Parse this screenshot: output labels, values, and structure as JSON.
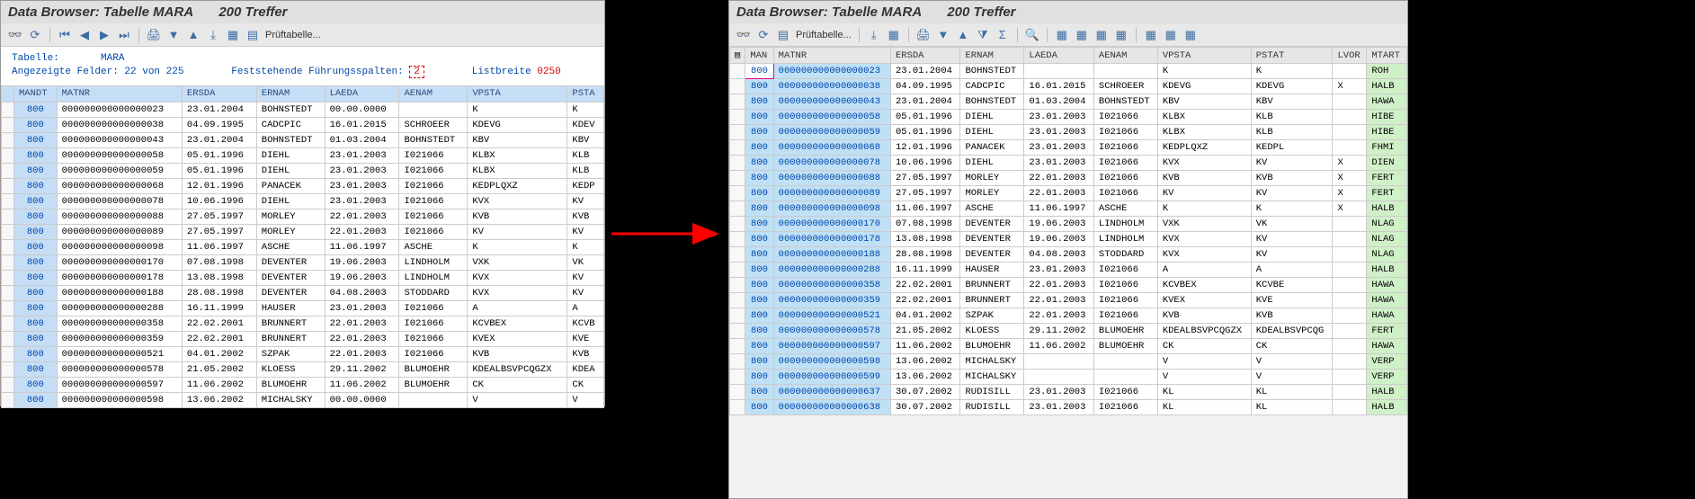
{
  "title_main": "Data Browser: Tabelle MARA",
  "title_hits": "200 Treffer",
  "tb_left_label": "Prüftabelle...",
  "tb_right_label": "Prüftabelle...",
  "info": {
    "tabelle_label": "Tabelle:",
    "tabelle_value": "MARA",
    "felder_label": "Angezeigte Felder: 22 von 225",
    "spalten_label": "Feststehende Führungsspalten:",
    "spalten_value": "2",
    "listbreite_label": "Listbreite",
    "listbreite_value": "0250"
  },
  "left_cols": [
    "",
    "MANDT",
    "MATNR",
    "ERSDA",
    "ERNAM",
    "LAEDA",
    "AENAM",
    "VPSTA",
    "PSTA"
  ],
  "right_cols": [
    "",
    "MAN",
    "MATNR",
    "ERSDA",
    "ERNAM",
    "LAEDA",
    "AENAM",
    "VPSTA",
    "PSTAT",
    "LVOR",
    "MTART"
  ],
  "left_rows": [
    [
      "800",
      "000000000000000023",
      "23.01.2004",
      "BOHNSTEDT",
      "00.00.0000",
      "",
      "K",
      "K"
    ],
    [
      "800",
      "000000000000000038",
      "04.09.1995",
      "CADCPIC",
      "16.01.2015",
      "SCHROEER",
      "KDEVG",
      "KDEV"
    ],
    [
      "800",
      "000000000000000043",
      "23.01.2004",
      "BOHNSTEDT",
      "01.03.2004",
      "BOHNSTEDT",
      "KBV",
      "KBV"
    ],
    [
      "800",
      "000000000000000058",
      "05.01.1996",
      "DIEHL",
      "23.01.2003",
      "I021066",
      "KLBX",
      "KLB"
    ],
    [
      "800",
      "000000000000000059",
      "05.01.1996",
      "DIEHL",
      "23.01.2003",
      "I021066",
      "KLBX",
      "KLB"
    ],
    [
      "800",
      "000000000000000068",
      "12.01.1996",
      "PANACEK",
      "23.01.2003",
      "I021066",
      "KEDPLQXZ",
      "KEDP"
    ],
    [
      "800",
      "000000000000000078",
      "10.06.1996",
      "DIEHL",
      "23.01.2003",
      "I021066",
      "KVX",
      "KV"
    ],
    [
      "800",
      "000000000000000088",
      "27.05.1997",
      "MORLEY",
      "22.01.2003",
      "I021066",
      "KVB",
      "KVB"
    ],
    [
      "800",
      "000000000000000089",
      "27.05.1997",
      "MORLEY",
      "22.01.2003",
      "I021066",
      "KV",
      "KV"
    ],
    [
      "800",
      "000000000000000098",
      "11.06.1997",
      "ASCHE",
      "11.06.1997",
      "ASCHE",
      "K",
      "K"
    ],
    [
      "800",
      "000000000000000170",
      "07.08.1998",
      "DEVENTER",
      "19.06.2003",
      "LINDHOLM",
      "VXK",
      "VK"
    ],
    [
      "800",
      "000000000000000178",
      "13.08.1998",
      "DEVENTER",
      "19.06.2003",
      "LINDHOLM",
      "KVX",
      "KV"
    ],
    [
      "800",
      "000000000000000188",
      "28.08.1998",
      "DEVENTER",
      "04.08.2003",
      "STODDARD",
      "KVX",
      "KV"
    ],
    [
      "800",
      "000000000000000288",
      "16.11.1999",
      "HAUSER",
      "23.01.2003",
      "I021066",
      "A",
      "A"
    ],
    [
      "800",
      "000000000000000358",
      "22.02.2001",
      "BRUNNERT",
      "22.01.2003",
      "I021066",
      "KCVBEX",
      "KCVB"
    ],
    [
      "800",
      "000000000000000359",
      "22.02.2001",
      "BRUNNERT",
      "22.01.2003",
      "I021066",
      "KVEX",
      "KVE"
    ],
    [
      "800",
      "000000000000000521",
      "04.01.2002",
      "SZPAK",
      "22.01.2003",
      "I021066",
      "KVB",
      "KVB"
    ],
    [
      "800",
      "000000000000000578",
      "21.05.2002",
      "KLOESS",
      "29.11.2002",
      "BLUMOEHR",
      "KDEALBSVPCQGZX",
      "KDEA"
    ],
    [
      "800",
      "000000000000000597",
      "11.06.2002",
      "BLUMOEHR",
      "11.06.2002",
      "BLUMOEHR",
      "CK",
      "CK"
    ],
    [
      "800",
      "000000000000000598",
      "13.06.2002",
      "MICHALSKY",
      "00.00.0000",
      "",
      "V",
      "V"
    ]
  ],
  "right_rows": [
    [
      "800",
      "000000000000000023",
      "23.01.2004",
      "BOHNSTEDT",
      "",
      "",
      "K",
      "K",
      "",
      "ROH"
    ],
    [
      "800",
      "000000000000000038",
      "04.09.1995",
      "CADCPIC",
      "16.01.2015",
      "SCHROEER",
      "KDEVG",
      "KDEVG",
      "X",
      "HALB"
    ],
    [
      "800",
      "000000000000000043",
      "23.01.2004",
      "BOHNSTEDT",
      "01.03.2004",
      "BOHNSTEDT",
      "KBV",
      "KBV",
      "",
      "HAWA"
    ],
    [
      "800",
      "000000000000000058",
      "05.01.1996",
      "DIEHL",
      "23.01.2003",
      "I021066",
      "KLBX",
      "KLB",
      "",
      "HIBE"
    ],
    [
      "800",
      "000000000000000059",
      "05.01.1996",
      "DIEHL",
      "23.01.2003",
      "I021066",
      "KLBX",
      "KLB",
      "",
      "HIBE"
    ],
    [
      "800",
      "000000000000000068",
      "12.01.1996",
      "PANACEK",
      "23.01.2003",
      "I021066",
      "KEDPLQXZ",
      "KEDPL",
      "",
      "FHMI"
    ],
    [
      "800",
      "000000000000000078",
      "10.06.1996",
      "DIEHL",
      "23.01.2003",
      "I021066",
      "KVX",
      "KV",
      "X",
      "DIEN"
    ],
    [
      "800",
      "000000000000000088",
      "27.05.1997",
      "MORLEY",
      "22.01.2003",
      "I021066",
      "KVB",
      "KVB",
      "X",
      "FERT"
    ],
    [
      "800",
      "000000000000000089",
      "27.05.1997",
      "MORLEY",
      "22.01.2003",
      "I021066",
      "KV",
      "KV",
      "X",
      "FERT"
    ],
    [
      "800",
      "000000000000000098",
      "11.06.1997",
      "ASCHE",
      "11.06.1997",
      "ASCHE",
      "K",
      "K",
      "X",
      "HALB"
    ],
    [
      "800",
      "000000000000000170",
      "07.08.1998",
      "DEVENTER",
      "19.06.2003",
      "LINDHOLM",
      "VXK",
      "VK",
      "",
      "NLAG"
    ],
    [
      "800",
      "000000000000000178",
      "13.08.1998",
      "DEVENTER",
      "19.06.2003",
      "LINDHOLM",
      "KVX",
      "KV",
      "",
      "NLAG"
    ],
    [
      "800",
      "000000000000000188",
      "28.08.1998",
      "DEVENTER",
      "04.08.2003",
      "STODDARD",
      "KVX",
      "KV",
      "",
      "NLAG"
    ],
    [
      "800",
      "000000000000000288",
      "16.11.1999",
      "HAUSER",
      "23.01.2003",
      "I021066",
      "A",
      "A",
      "",
      "HALB"
    ],
    [
      "800",
      "000000000000000358",
      "22.02.2001",
      "BRUNNERT",
      "22.01.2003",
      "I021066",
      "KCVBEX",
      "KCVBE",
      "",
      "HAWA"
    ],
    [
      "800",
      "000000000000000359",
      "22.02.2001",
      "BRUNNERT",
      "22.01.2003",
      "I021066",
      "KVEX",
      "KVE",
      "",
      "HAWA"
    ],
    [
      "800",
      "000000000000000521",
      "04.01.2002",
      "SZPAK",
      "22.01.2003",
      "I021066",
      "KVB",
      "KVB",
      "",
      "HAWA"
    ],
    [
      "800",
      "000000000000000578",
      "21.05.2002",
      "KLOESS",
      "29.11.2002",
      "BLUMOEHR",
      "KDEALBSVPCQGZX",
      "KDEALBSVPCQG",
      "",
      "FERT"
    ],
    [
      "800",
      "000000000000000597",
      "11.06.2002",
      "BLUMOEHR",
      "11.06.2002",
      "BLUMOEHR",
      "CK",
      "CK",
      "",
      "HAWA"
    ],
    [
      "800",
      "000000000000000598",
      "13.06.2002",
      "MICHALSKY",
      "",
      "",
      "V",
      "V",
      "",
      "VERP"
    ],
    [
      "800",
      "000000000000000599",
      "13.06.2002",
      "MICHALSKY",
      "",
      "",
      "V",
      "V",
      "",
      "VERP"
    ],
    [
      "800",
      "000000000000000637",
      "30.07.2002",
      "RUDISILL",
      "23.01.2003",
      "I021066",
      "KL",
      "KL",
      "",
      "HALB"
    ],
    [
      "800",
      "000000000000000638",
      "30.07.2002",
      "RUDISILL",
      "23.01.2003",
      "I021066",
      "KL",
      "KL",
      "",
      "HALB"
    ]
  ]
}
